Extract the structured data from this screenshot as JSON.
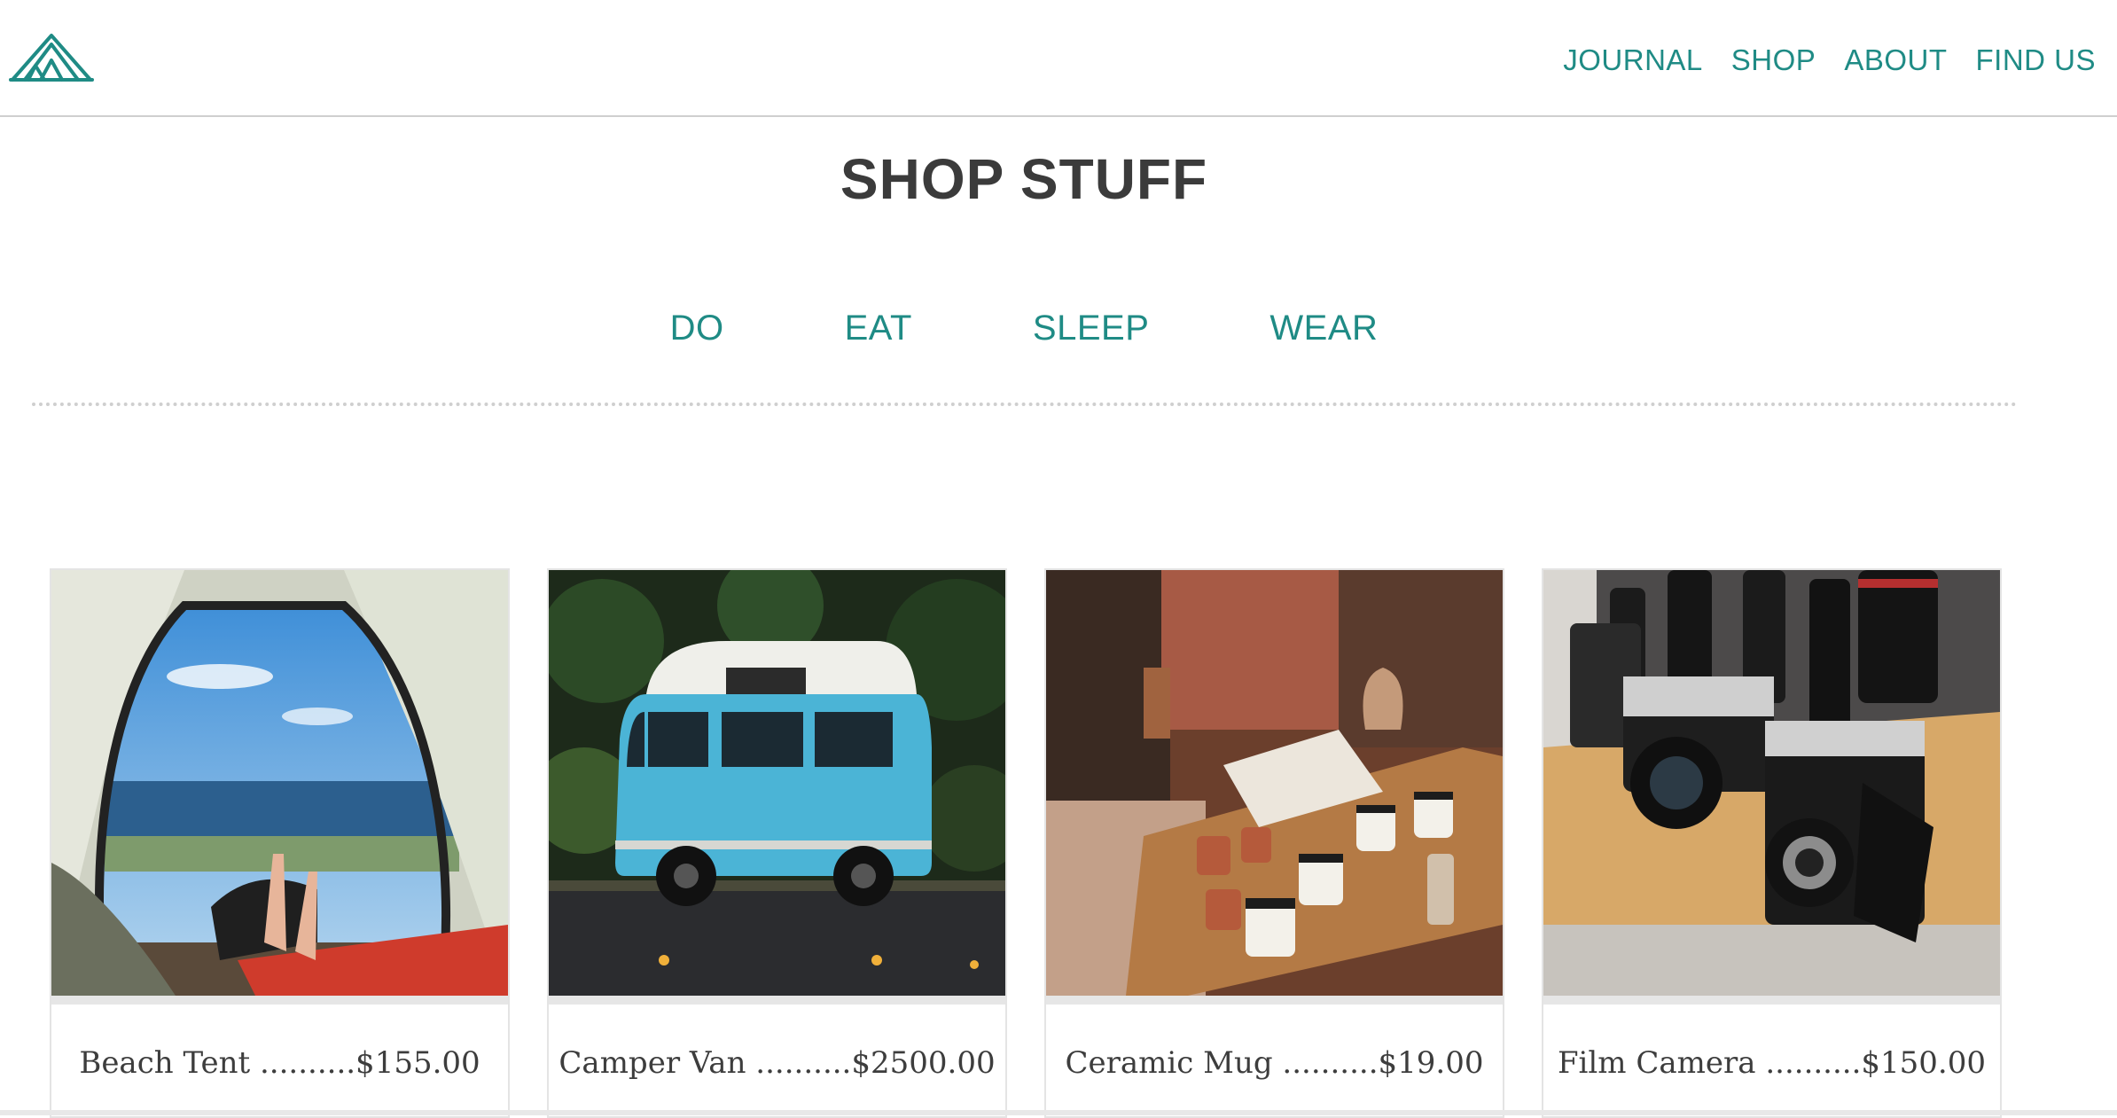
{
  "brand": {
    "logo_icon": "tent-logo-icon",
    "accent_color": "#1f8b85"
  },
  "nav": {
    "items": [
      {
        "label": "JOURNAL"
      },
      {
        "label": "SHOP"
      },
      {
        "label": "ABOUT"
      },
      {
        "label": "FIND US"
      }
    ]
  },
  "page": {
    "title": "SHOP STUFF"
  },
  "categories": [
    {
      "label": "DO"
    },
    {
      "label": "EAT"
    },
    {
      "label": "SLEEP"
    },
    {
      "label": "WEAR"
    }
  ],
  "products": [
    {
      "name": "Beach Tent",
      "price": "$155.00",
      "caption": "Beach Tent ..........$155.00",
      "image": "tent-beach-photo"
    },
    {
      "name": "Camper Van",
      "price": "$2500.00",
      "caption": "Camper Van ..........$2500.00",
      "image": "blue-camper-van-photo"
    },
    {
      "name": "Ceramic Mug",
      "price": "$19.00",
      "caption": "Ceramic Mug ..........$19.00",
      "image": "ceramic-mugs-photo"
    },
    {
      "name": "Film Camera",
      "price": "$150.00",
      "caption": "Film Camera ..........$150.00",
      "image": "film-cameras-photo"
    }
  ]
}
